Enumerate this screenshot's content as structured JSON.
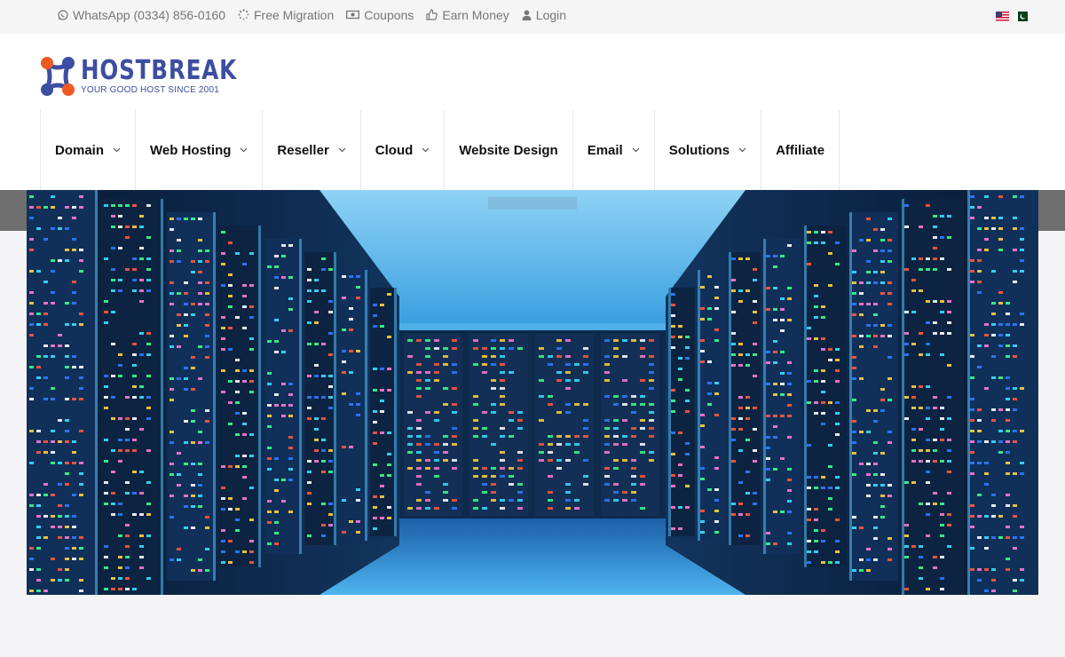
{
  "topbar": {
    "links": [
      {
        "label": "WhatsApp (0334) 856-0160",
        "icon": "whatsapp-icon"
      },
      {
        "label": "Free Migration",
        "icon": "spinner-icon"
      },
      {
        "label": "Coupons",
        "icon": "money-icon"
      },
      {
        "label": "Earn Money",
        "icon": "thumbs-up-icon"
      },
      {
        "label": "Login",
        "icon": "user-icon"
      }
    ],
    "flags": [
      "us-flag-icon",
      "pk-flag-icon"
    ]
  },
  "logo": {
    "name": "HOSTBREAK",
    "tagline": "YOUR GOOD HOST SINCE 2001",
    "colors": {
      "blue": "#3d4ea0",
      "orange": "#f05a22"
    }
  },
  "nav": {
    "items": [
      {
        "label": "Domain",
        "has_dropdown": true
      },
      {
        "label": "Web Hosting",
        "has_dropdown": true
      },
      {
        "label": "Reseller",
        "has_dropdown": true
      },
      {
        "label": "Cloud",
        "has_dropdown": true
      },
      {
        "label": "Website Design",
        "has_dropdown": false
      },
      {
        "label": "Email",
        "has_dropdown": true
      },
      {
        "label": "Solutions",
        "has_dropdown": true
      },
      {
        "label": "Affiliate",
        "has_dropdown": false
      }
    ]
  },
  "hero": {
    "image": "data-center-server-racks"
  }
}
